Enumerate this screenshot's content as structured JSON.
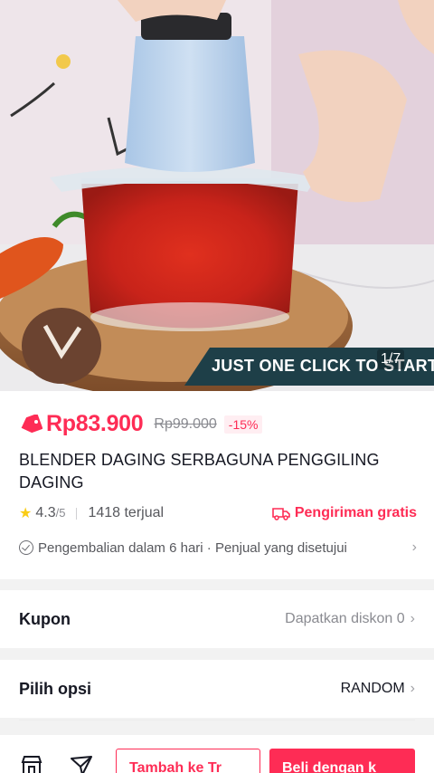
{
  "gallery": {
    "banner_text": "JUST ONE CLICK TO START",
    "counter": "1/7"
  },
  "product": {
    "price": "Rp83.900",
    "original_price": "Rp99.000",
    "discount": "-15%",
    "title": "BLENDER DAGING SERBAGUNA PENGGILING DAGING",
    "rating": "4.3",
    "rating_scale": "/5",
    "sold": "1418 terjual",
    "shipping": "Pengiriman gratis",
    "return_policy": "Pengembalian dalam 6 hari · Penjual yang disetujui"
  },
  "coupon": {
    "label": "Kupon",
    "value": "Dapatkan diskon 0"
  },
  "options": {
    "label": "Pilih opsi",
    "value": "RANDOM"
  },
  "bottom_bar": {
    "add_to_cart": "Tambah ke Tr",
    "buy_now": "Beli dengan k"
  },
  "colors": {
    "accent": "#fe2c55",
    "banner": "#1e3f48"
  },
  "icons": [
    "shop-icon",
    "chat-icon",
    "price-tag-icon",
    "star-icon",
    "truck-icon",
    "check-circle-icon",
    "chevron-right-icon"
  ]
}
